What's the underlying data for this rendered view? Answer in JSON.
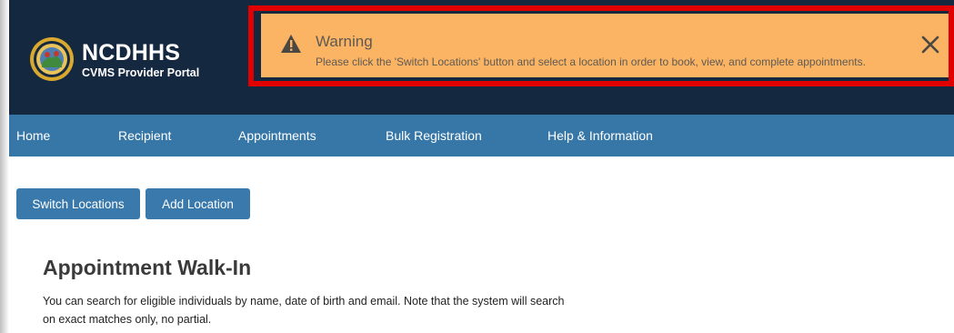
{
  "brand": {
    "title": "NCDHHS",
    "subtitle": "CVMS Provider Portal"
  },
  "warning": {
    "icon": "warning-triangle-icon",
    "title": "Warning",
    "message": "Please click the 'Switch Locations' button and select a location in order to book, view, and complete appointments.",
    "close_icon": "close-icon",
    "background_color": "#fbb463",
    "highlight_border_color": "#e10000"
  },
  "nav": {
    "items": [
      {
        "label": "Home"
      },
      {
        "label": "Recipient"
      },
      {
        "label": "Appointments"
      },
      {
        "label": "Bulk Registration"
      },
      {
        "label": "Help & Information"
      }
    ],
    "background_color": "#3777a8"
  },
  "actions": {
    "switch_locations": "Switch Locations",
    "add_location": "Add Location"
  },
  "main": {
    "title": "Appointment Walk-In",
    "description": "You can search for eligible individuals by name, date of birth and email. Note that the system will search on exact matches only, no partial."
  },
  "colors": {
    "header_bg": "#142840",
    "button_bg": "#3a79ab"
  }
}
